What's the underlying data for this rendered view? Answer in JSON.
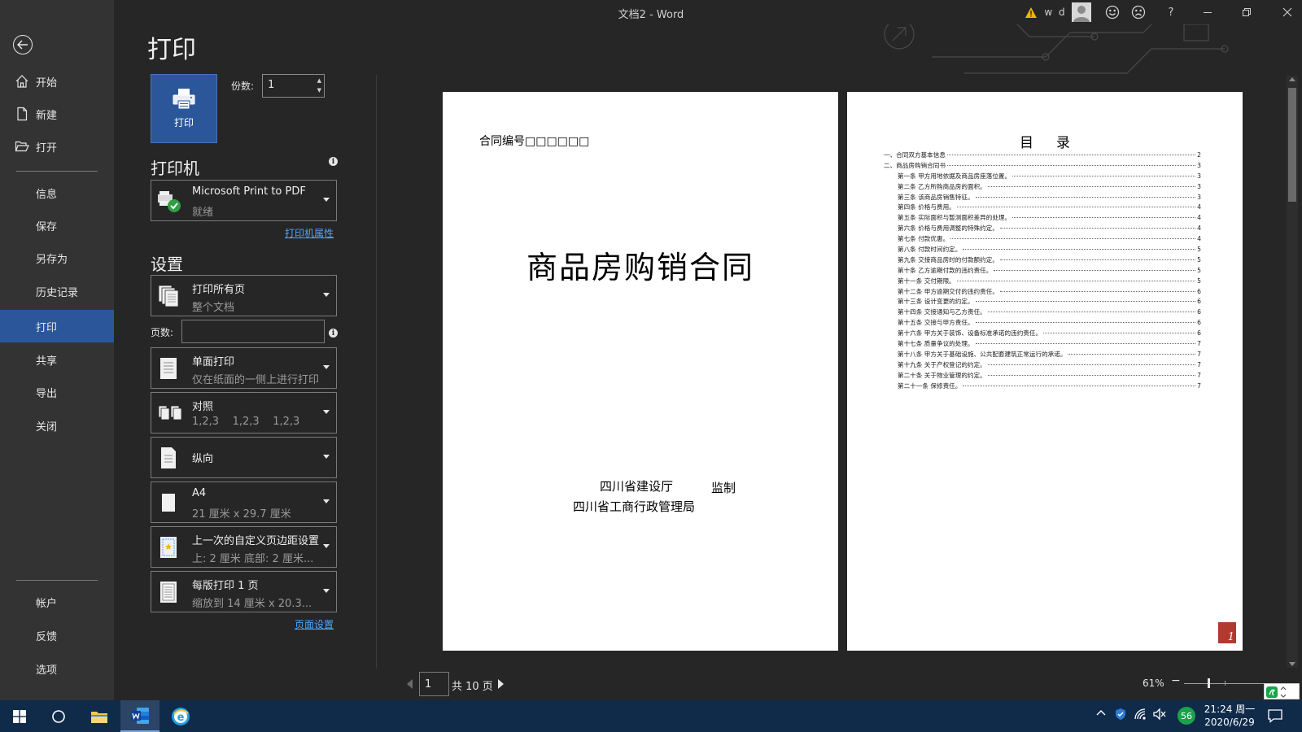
{
  "window": {
    "title": "文档2 - Word",
    "user_name": "w d"
  },
  "backstage": {
    "items": [
      {
        "key": "home",
        "label": "开始",
        "icon": "home-icon"
      },
      {
        "key": "new",
        "label": "新建",
        "icon": "new-doc-icon"
      },
      {
        "key": "open",
        "label": "打开",
        "icon": "folder-open-icon"
      },
      {
        "key": "info",
        "label": "信息"
      },
      {
        "key": "save",
        "label": "保存"
      },
      {
        "key": "saveas",
        "label": "另存为"
      },
      {
        "key": "history",
        "label": "历史记录"
      },
      {
        "key": "print",
        "label": "打印",
        "active": true
      },
      {
        "key": "share",
        "label": "共享"
      },
      {
        "key": "export",
        "label": "导出"
      },
      {
        "key": "close",
        "label": "关闭"
      },
      {
        "key": "account",
        "label": "帐户"
      },
      {
        "key": "feedback",
        "label": "反馈"
      },
      {
        "key": "options",
        "label": "选项"
      }
    ]
  },
  "print": {
    "title": "打印",
    "button_label": "打印",
    "copies_label": "份数:",
    "copies_value": "1",
    "printer_heading": "打印机",
    "printer": {
      "name": "Microsoft Print to PDF",
      "status": "就绪"
    },
    "printer_properties_link": "打印机属性",
    "settings_heading": "设置",
    "range": {
      "main": "打印所有页",
      "sub": "整个文档"
    },
    "pages_label": "页数:",
    "pages_value": "",
    "sides": {
      "main": "单面打印",
      "sub": "仅在纸面的一侧上进行打印"
    },
    "collate": {
      "main": "对照",
      "sub": "1,2,3    1,2,3    1,2,3"
    },
    "orientation": {
      "main": "纵向"
    },
    "paper": {
      "main": "A4",
      "sub": "21 厘米 x 29.7 厘米"
    },
    "margins": {
      "main": "上一次的自定义页边距设置",
      "sub": "上: 2 厘米 底部: 2 厘米..."
    },
    "per_sheet": {
      "main": "每版打印 1 页",
      "sub": "缩放到 14 厘米 x 20.3..."
    },
    "page_setup_link": "页面设置"
  },
  "preview": {
    "page1": {
      "contract_no": "合同编号□□□□□□",
      "title": "商品房购销合同",
      "issuer_1": "四川省建设厅",
      "issuer_suffix": "监制",
      "issuer_2": "四川省工商行政管理局"
    },
    "page2": {
      "toc_title": "目录",
      "page_badge": "1",
      "toc": [
        {
          "text": "一、合同双方基本信息",
          "page": "2",
          "indent": false
        },
        {
          "text": "二、商品房购销合同书",
          "page": "3",
          "indent": false
        },
        {
          "text": "第一条 甲方用地依据及商品房座落位置。",
          "page": "3",
          "indent": true
        },
        {
          "text": "第二条 乙方所购商品房的面积。",
          "page": "3",
          "indent": true
        },
        {
          "text": "第三条 该商品房销售特征。",
          "page": "3",
          "indent": true
        },
        {
          "text": "第四条 价格与费用。",
          "page": "4",
          "indent": true
        },
        {
          "text": "第五条 实际面积与暂测面积差异的处理。",
          "page": "4",
          "indent": true
        },
        {
          "text": "第六条 价格与费用调整的特殊约定。",
          "page": "4",
          "indent": true
        },
        {
          "text": "第七条 付款优惠。",
          "page": "4",
          "indent": true
        },
        {
          "text": "第八条 付款时间约定。",
          "page": "5",
          "indent": true
        },
        {
          "text": "第九条 交接商品房时的付款额约定。",
          "page": "5",
          "indent": true
        },
        {
          "text": "第十条 乙方逾期付款的违约责任。",
          "page": "5",
          "indent": true
        },
        {
          "text": "第十一条 交付期限。",
          "page": "5",
          "indent": true
        },
        {
          "text": "第十二条 甲方逾期交付的违约责任。",
          "page": "6",
          "indent": true
        },
        {
          "text": "第十三条 设计变更的约定。",
          "page": "6",
          "indent": true
        },
        {
          "text": "第十四条 交接通知与乙方责任。",
          "page": "6",
          "indent": true
        },
        {
          "text": "第十五条 交接与甲方责任。",
          "page": "6",
          "indent": true
        },
        {
          "text": "第十六条 甲方关于装饰、设备标准承诺的违约责任。",
          "page": "6",
          "indent": true
        },
        {
          "text": "第十七条 质量争议的处理。",
          "page": "7",
          "indent": true
        },
        {
          "text": "第十八条 甲方关于基础设施、公共配套建筑正常运行的承诺。",
          "page": "7",
          "indent": true
        },
        {
          "text": "第十九条 关于产权登记的约定。",
          "page": "7",
          "indent": true
        },
        {
          "text": "第二十条 关于物业管理的约定。",
          "page": "7",
          "indent": true
        },
        {
          "text": "第二十一条 保修责任。",
          "page": "7",
          "indent": true
        }
      ]
    }
  },
  "pager": {
    "current_page": "1",
    "total_label": "共 10 页",
    "zoom": "61%",
    "zoom_minus": "−"
  },
  "taskbar": {
    "tray_badge": "56",
    "time": "21:24 周一",
    "date": "2020/6/29"
  },
  "colors": {
    "accent": "#2b579a",
    "link": "#4ea6ff",
    "taskbar": "#102a4a"
  }
}
